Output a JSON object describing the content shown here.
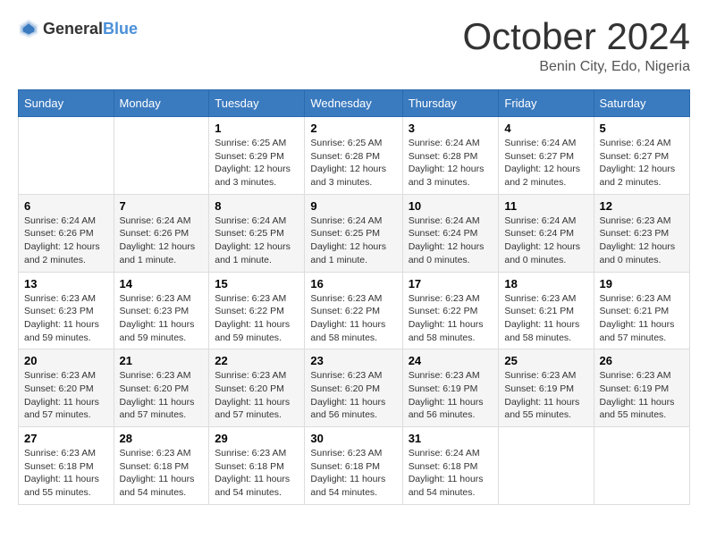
{
  "header": {
    "logo_general": "General",
    "logo_blue": "Blue",
    "month": "October 2024",
    "location": "Benin City, Edo, Nigeria"
  },
  "days_of_week": [
    "Sunday",
    "Monday",
    "Tuesday",
    "Wednesday",
    "Thursday",
    "Friday",
    "Saturday"
  ],
  "weeks": [
    [
      {
        "day": "",
        "info": ""
      },
      {
        "day": "",
        "info": ""
      },
      {
        "day": "1",
        "info": "Sunrise: 6:25 AM\nSunset: 6:29 PM\nDaylight: 12 hours and 3 minutes."
      },
      {
        "day": "2",
        "info": "Sunrise: 6:25 AM\nSunset: 6:28 PM\nDaylight: 12 hours and 3 minutes."
      },
      {
        "day": "3",
        "info": "Sunrise: 6:24 AM\nSunset: 6:28 PM\nDaylight: 12 hours and 3 minutes."
      },
      {
        "day": "4",
        "info": "Sunrise: 6:24 AM\nSunset: 6:27 PM\nDaylight: 12 hours and 2 minutes."
      },
      {
        "day": "5",
        "info": "Sunrise: 6:24 AM\nSunset: 6:27 PM\nDaylight: 12 hours and 2 minutes."
      }
    ],
    [
      {
        "day": "6",
        "info": "Sunrise: 6:24 AM\nSunset: 6:26 PM\nDaylight: 12 hours and 2 minutes."
      },
      {
        "day": "7",
        "info": "Sunrise: 6:24 AM\nSunset: 6:26 PM\nDaylight: 12 hours and 1 minute."
      },
      {
        "day": "8",
        "info": "Sunrise: 6:24 AM\nSunset: 6:25 PM\nDaylight: 12 hours and 1 minute."
      },
      {
        "day": "9",
        "info": "Sunrise: 6:24 AM\nSunset: 6:25 PM\nDaylight: 12 hours and 1 minute."
      },
      {
        "day": "10",
        "info": "Sunrise: 6:24 AM\nSunset: 6:24 PM\nDaylight: 12 hours and 0 minutes."
      },
      {
        "day": "11",
        "info": "Sunrise: 6:24 AM\nSunset: 6:24 PM\nDaylight: 12 hours and 0 minutes."
      },
      {
        "day": "12",
        "info": "Sunrise: 6:23 AM\nSunset: 6:23 PM\nDaylight: 12 hours and 0 minutes."
      }
    ],
    [
      {
        "day": "13",
        "info": "Sunrise: 6:23 AM\nSunset: 6:23 PM\nDaylight: 11 hours and 59 minutes."
      },
      {
        "day": "14",
        "info": "Sunrise: 6:23 AM\nSunset: 6:23 PM\nDaylight: 11 hours and 59 minutes."
      },
      {
        "day": "15",
        "info": "Sunrise: 6:23 AM\nSunset: 6:22 PM\nDaylight: 11 hours and 59 minutes."
      },
      {
        "day": "16",
        "info": "Sunrise: 6:23 AM\nSunset: 6:22 PM\nDaylight: 11 hours and 58 minutes."
      },
      {
        "day": "17",
        "info": "Sunrise: 6:23 AM\nSunset: 6:22 PM\nDaylight: 11 hours and 58 minutes."
      },
      {
        "day": "18",
        "info": "Sunrise: 6:23 AM\nSunset: 6:21 PM\nDaylight: 11 hours and 58 minutes."
      },
      {
        "day": "19",
        "info": "Sunrise: 6:23 AM\nSunset: 6:21 PM\nDaylight: 11 hours and 57 minutes."
      }
    ],
    [
      {
        "day": "20",
        "info": "Sunrise: 6:23 AM\nSunset: 6:20 PM\nDaylight: 11 hours and 57 minutes."
      },
      {
        "day": "21",
        "info": "Sunrise: 6:23 AM\nSunset: 6:20 PM\nDaylight: 11 hours and 57 minutes."
      },
      {
        "day": "22",
        "info": "Sunrise: 6:23 AM\nSunset: 6:20 PM\nDaylight: 11 hours and 57 minutes."
      },
      {
        "day": "23",
        "info": "Sunrise: 6:23 AM\nSunset: 6:20 PM\nDaylight: 11 hours and 56 minutes."
      },
      {
        "day": "24",
        "info": "Sunrise: 6:23 AM\nSunset: 6:19 PM\nDaylight: 11 hours and 56 minutes."
      },
      {
        "day": "25",
        "info": "Sunrise: 6:23 AM\nSunset: 6:19 PM\nDaylight: 11 hours and 55 minutes."
      },
      {
        "day": "26",
        "info": "Sunrise: 6:23 AM\nSunset: 6:19 PM\nDaylight: 11 hours and 55 minutes."
      }
    ],
    [
      {
        "day": "27",
        "info": "Sunrise: 6:23 AM\nSunset: 6:18 PM\nDaylight: 11 hours and 55 minutes."
      },
      {
        "day": "28",
        "info": "Sunrise: 6:23 AM\nSunset: 6:18 PM\nDaylight: 11 hours and 54 minutes."
      },
      {
        "day": "29",
        "info": "Sunrise: 6:23 AM\nSunset: 6:18 PM\nDaylight: 11 hours and 54 minutes."
      },
      {
        "day": "30",
        "info": "Sunrise: 6:23 AM\nSunset: 6:18 PM\nDaylight: 11 hours and 54 minutes."
      },
      {
        "day": "31",
        "info": "Sunrise: 6:24 AM\nSunset: 6:18 PM\nDaylight: 11 hours and 54 minutes."
      },
      {
        "day": "",
        "info": ""
      },
      {
        "day": "",
        "info": ""
      }
    ]
  ]
}
